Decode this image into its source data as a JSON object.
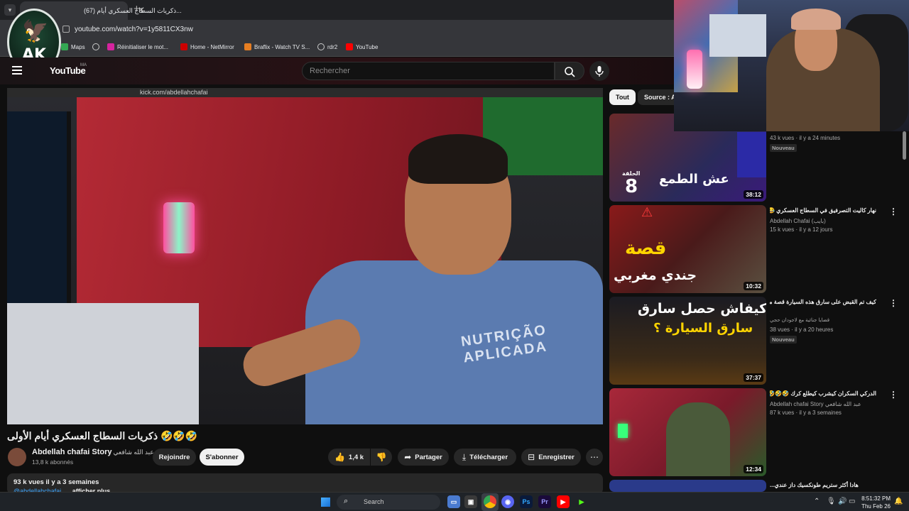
{
  "browser": {
    "tab_title": "(67) ذكريات السطاج العسكري أيام...",
    "url": "youtube.com/watch?v=1y5811CX3nw",
    "bookmarks": [
      "Maps",
      "Réinitialiser le mot...",
      "Home - NetMirror",
      "Braflix - Watch TV S...",
      "rdr2",
      "YouTube"
    ]
  },
  "logo": {
    "text": "AK"
  },
  "youtube": {
    "logo": "YouTube",
    "region": "MA",
    "search_placeholder": "Rechercher"
  },
  "player": {
    "inner_url": "kick.com/abdellahchafai",
    "shirt_text": "NUTRIÇÃO APLICADA"
  },
  "video": {
    "title": "ذكريات السطاج العسكري أيام الأولى 🤣🤣🤣",
    "channel": "Abdellah chafai Story",
    "channel_ar": "عبد الله شافعي",
    "subscribers": "13,8 k abonnés",
    "join": "Rejoindre",
    "subscribe": "S'abonner",
    "likes": "1,4 k",
    "share": "Partager",
    "download": "Télécharger",
    "save": "Enregistrer",
    "desc_meta": "93 k vues  il y a 3 semaines",
    "desc_handle": "@abdellahchafai",
    "desc_more": "...afficher plus"
  },
  "chips": [
    "Tout",
    "Source : A"
  ],
  "recommendations": [
    {
      "title": "",
      "channel": "",
      "meta": "43 k vues · il y a 24 minutes",
      "badge": "Nouveau",
      "duration": "38:12",
      "thumb_text": "عش الطمع",
      "thumb_num": "8",
      "thumb_sub": "الحلقة"
    },
    {
      "title": "نهار كاليت التصرفيق في السطاج العسكري 😂😂",
      "channel": "Abdellah Chafai (بايب)",
      "meta": "15 k vues · il y a 12 jours",
      "badge": "",
      "duration": "10:32",
      "thumb_text": "قصة",
      "thumb_sub": "جندي مغربي"
    },
    {
      "title": "كيف تم القبض على سارق هذه السيارة قصة مشوقة مع لاجودان حجي",
      "channel": "قضايا جنائية مع لاجودان حجي",
      "meta": "38 vues · il y a 20 heures",
      "badge": "Nouveau",
      "duration": "37:37",
      "thumb_text": "كيفاش حصل سارق",
      "thumb_sub": "سارق السيارة ؟"
    },
    {
      "title": "الدركي السكران كيشرب كيطلع كرك 🤣🤣🤣",
      "channel": "Abdellah chafai Story عبد الله شافعي",
      "meta": "87 k vues · il y a 3 semaines",
      "badge": "",
      "duration": "12:34",
      "thumb_text": "",
      "thumb_sub": ""
    },
    {
      "title": "هادا أكثر ستريم طونكسيك داز عندي...",
      "channel": "",
      "meta": "",
      "badge": "",
      "duration": "",
      "thumb_text": "",
      "thumb_sub": ""
    }
  ],
  "taskbar": {
    "search": "Search",
    "time": "8:51:32 PM",
    "date": "Thu Feb 26"
  },
  "colors": {
    "accent_link": "#3ea6ff",
    "bg": "#0f0f0f",
    "button_dark": "#272727"
  }
}
